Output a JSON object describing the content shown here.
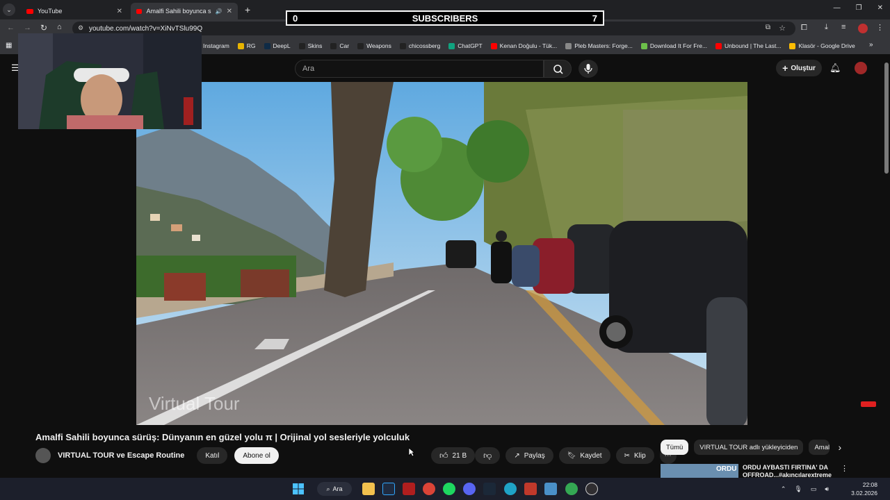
{
  "browser": {
    "tabs": [
      {
        "label": "YouTube"
      },
      {
        "label": "Amalfi Sahili boyunca sürüş"
      }
    ],
    "url": "youtube.com/watch?v=XiNvTSlu99Q",
    "bookmarks": [
      {
        "label": "Instagram"
      },
      {
        "label": "RG"
      },
      {
        "label": "DeepL"
      },
      {
        "label": "Skins"
      },
      {
        "label": "Car"
      },
      {
        "label": "Weapons"
      },
      {
        "label": "chicossberg"
      },
      {
        "label": "ChatGPT"
      },
      {
        "label": "Kenan Doğulu - Tük..."
      },
      {
        "label": "Pleb Masters: Forge..."
      },
      {
        "label": "Download It For Fre..."
      },
      {
        "label": "Unbound | The Last..."
      },
      {
        "label": "Klasör - Google Drive"
      }
    ]
  },
  "overlay": {
    "subscribers_left": "0",
    "subscribers_label": "SUBSCRIBERS",
    "subscribers_right": "7"
  },
  "youtube": {
    "search_placeholder": "Ara",
    "create_label": "Oluştur",
    "video": {
      "watermark": "Virtual Tour",
      "title": "Amalfi Sahili boyunca sürüş: Dünyanın en güzel yolu π | Orijinal yol sesleriyle yolculuk",
      "channel": "VIRTUAL TOUR ve Escape Routine",
      "join_label": "Katıl",
      "subscribe_label": "Abone ol",
      "likes": "21 B",
      "share_label": "Paylaş",
      "save_label": "Kaydet",
      "clip_label": "Klip"
    },
    "chips": [
      {
        "label": "Tümü"
      },
      {
        "label": "VIRTUAL TOUR adlı yükleyiciden"
      },
      {
        "label": "Amal"
      }
    ],
    "recommendation": {
      "title_line1": "ORDU AYBASTI FIRTINA' DA",
      "title_line2": "OFFROAD...#akıncılarextreme",
      "thumb_text": "ORDU"
    }
  },
  "taskbar": {
    "search_label": "Ara",
    "time": "22:08",
    "date": "3.02.2026"
  }
}
